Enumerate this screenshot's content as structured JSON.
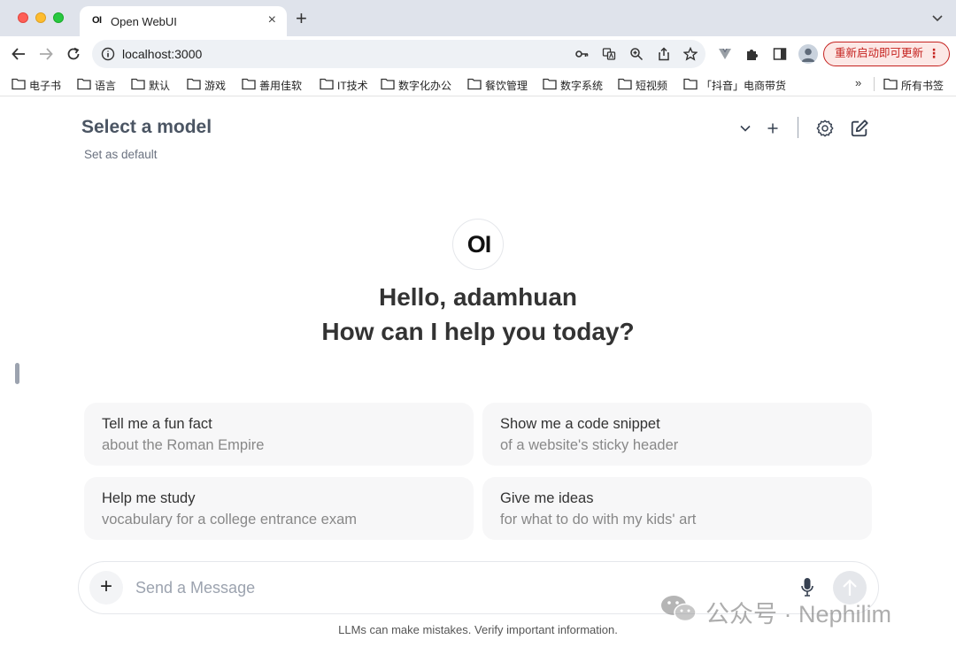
{
  "browser": {
    "tab_title": "Open WebUI",
    "tab_favicon_text": "OI",
    "url": "localhost:3000",
    "update_button_label": "重新启动即可更新",
    "bookmarks": [
      "电子书",
      "语言",
      "默认",
      "游戏",
      "善用佳软",
      "IT技术",
      "数字化办公",
      "餐饮管理",
      "数字系统",
      "短视频",
      "「抖音」电商带货"
    ],
    "bookmarks_overflow": "»",
    "all_bookmarks_label": "所有书签"
  },
  "header": {
    "model_title": "Select a model",
    "set_default_label": "Set as default"
  },
  "welcome": {
    "logo_text": "OI",
    "greeting": "Hello, adamhuan",
    "prompt": "How can I help you today?"
  },
  "suggestions": [
    {
      "title": "Tell me a fun fact",
      "subtitle": "about the Roman Empire"
    },
    {
      "title": "Show me a code snippet",
      "subtitle": "of a website's sticky header"
    },
    {
      "title": "Help me study",
      "subtitle": "vocabulary for a college entrance exam"
    },
    {
      "title": "Give me ideas",
      "subtitle": "for what to do with my kids' art"
    }
  ],
  "composer": {
    "placeholder": "Send a Message",
    "value": ""
  },
  "footer": {
    "disclaimer": "LLMs can make mistakes. Verify important information."
  },
  "watermark": {
    "text": "公众号 · Nephilim"
  },
  "colors": {
    "update_red": "#c5221f",
    "card_bg": "#f7f7f8",
    "tabstrip_bg": "#dfe3eb"
  }
}
